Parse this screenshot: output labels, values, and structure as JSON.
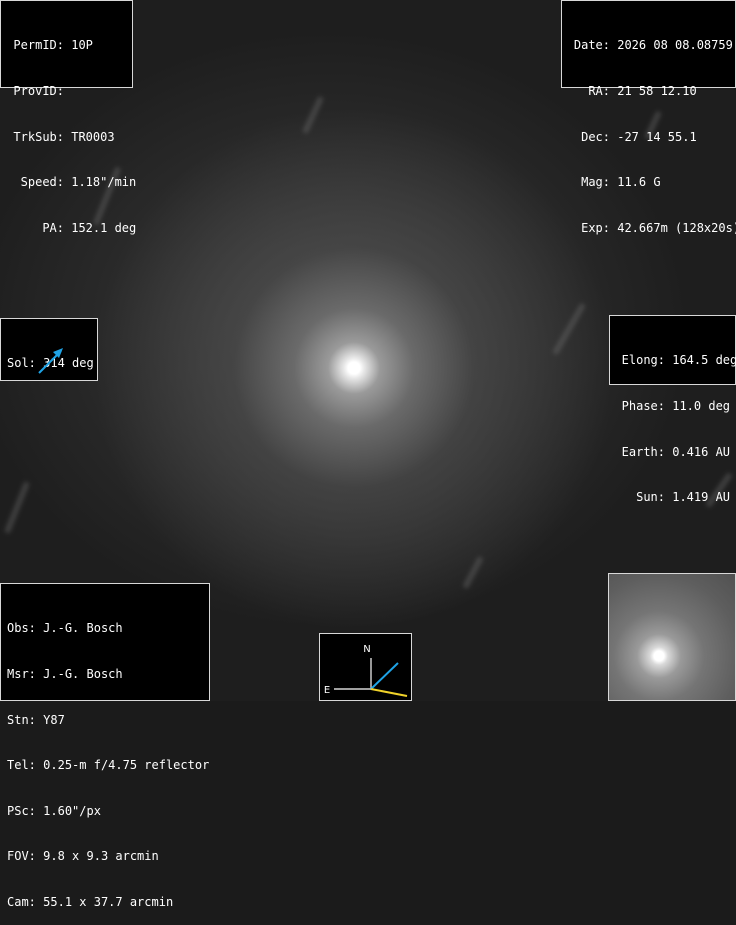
{
  "target_info": {
    "perm_id": {
      "label": "PermID:",
      "value": "10P"
    },
    "prov_id": {
      "label": "ProvID:",
      "value": ""
    },
    "trk_sub": {
      "label": "TrkSub:",
      "value": "TR0003"
    },
    "speed": {
      "label": "Speed:",
      "value": "1.18\"/min"
    },
    "pa": {
      "label": "PA:",
      "value": "152.1 deg"
    }
  },
  "observation_info": {
    "date": {
      "label": "Date:",
      "value": "2026 08 08.08759"
    },
    "ra": {
      "label": "RA:",
      "value": "21 58 12.10"
    },
    "dec": {
      "label": "Dec:",
      "value": "-27 14 55.1"
    },
    "mag": {
      "label": "Mag:",
      "value": "11.6 G"
    },
    "exp": {
      "label": "Exp:",
      "value": "42.667m (128x20s)"
    }
  },
  "solar": {
    "label": "Sol:",
    "value": "314 deg",
    "arrow_color": "#1fa3e6"
  },
  "geometry": {
    "elong": {
      "label": "Elong:",
      "value": "164.5 deg"
    },
    "phase": {
      "label": "Phase:",
      "value": "11.0 deg"
    },
    "earth": {
      "label": "Earth:",
      "value": "0.416 AU"
    },
    "sun": {
      "label": "Sun:",
      "value": "1.419 AU"
    }
  },
  "station_info": {
    "obs": {
      "label": "Obs:",
      "value": "J.-G. Bosch"
    },
    "msr": {
      "label": "Msr:",
      "value": "J.-G. Bosch"
    },
    "stn": {
      "label": "Stn:",
      "value": "Y87"
    },
    "tel": {
      "label": "Tel:",
      "value": "0.25-m f/4.75 reflector"
    },
    "psc": {
      "label": "PSc:",
      "value": "1.60\"/px"
    },
    "fov": {
      "label": "FOV:",
      "value": "9.8 x 9.3 arcmin"
    },
    "cam": {
      "label": "Cam:",
      "value": "55.1 x 37.7 arcmin"
    }
  },
  "compass": {
    "north_label": "N",
    "east_label": "E",
    "motion_color": "#1fa3e6",
    "sun_color": "#f0d22a",
    "axis_color": "#ffffff"
  },
  "colors": {
    "background": "#1b1b1b",
    "panel": "#000000",
    "panel_border": "#d8d8d8",
    "text": "#ffffff"
  }
}
